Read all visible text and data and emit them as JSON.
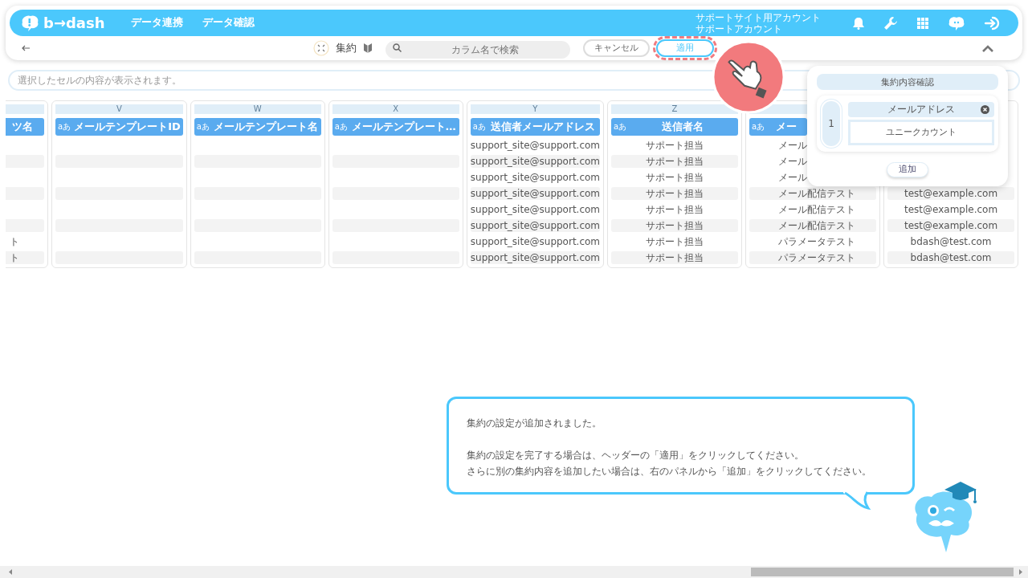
{
  "app": {
    "logo": "b→dash",
    "nav": [
      "データ連携",
      "データ確認"
    ],
    "account": [
      "サポートサイト用アカウント",
      "サポートアカウント"
    ]
  },
  "toolbar": {
    "mode_label": "集約",
    "search": {
      "placeholder": "カラム名で検索"
    },
    "buttons": [
      {
        "label": "キャンセル",
        "highlighted": false
      },
      {
        "label": "適用",
        "highlighted": true
      }
    ]
  },
  "cell_viewer": {
    "placeholder": "選択したセルの内容が表示されます。"
  },
  "columns": [
    {
      "header": "ツ名",
      "cells": [
        "ト",
        "ト"
      ]
    },
    {
      "letter": "V",
      "type_label": "aあ",
      "header": "メールテンプレートID"
    },
    {
      "letter": "W",
      "type_label": "aあ",
      "header": "メールテンプレート名"
    },
    {
      "letter": "X",
      "type_label": "aあ",
      "header": "メールテンプレート…"
    },
    {
      "letter": "Y",
      "type_label": "aあ",
      "header": "送信者メールアドレス",
      "cells": [
        "support_site@support.com",
        "support_site@support.com",
        "support_site@support.com",
        "support_site@support.com",
        "support_site@support.com",
        "support_site@support.com",
        "support_site@support.com",
        "support_site@support.com"
      ]
    },
    {
      "letter": "Z",
      "type_label": "aあ",
      "header": "送信者名",
      "cells": [
        "サポート担当",
        "サポート担当",
        "サポート担当",
        "サポート担当",
        "サポート担当",
        "サポート担当",
        "サポート担当",
        "サポート担当"
      ]
    },
    {
      "type_label": "aあ",
      "header": "メー",
      "cells": [
        "メール",
        "メール",
        "メール",
        "メール配信テスト",
        "メール配信テスト",
        "メール配信テスト",
        "パラメータテスト",
        "パラメータテスト"
      ]
    },
    {
      "cells": [
        "test@example.com",
        "test@example.com",
        "test@example.com",
        "bdash@test.com",
        "bdash@test.com"
      ]
    }
  ],
  "panel": {
    "title": "集約内容確認",
    "items": [
      {
        "number": "1",
        "column": "メールアドレス",
        "method": "ユニークカウント"
      }
    ],
    "add_button": "追加"
  },
  "tutorial": {
    "message": [
      "集約の設定が追加されました。",
      "集約の設定を完了する場合は、ヘッダーの「適用」をクリックしてください。",
      "さらに別の集約内容を追加したい場合は、右のパネルから「追加」をクリックしてください。"
    ]
  }
}
